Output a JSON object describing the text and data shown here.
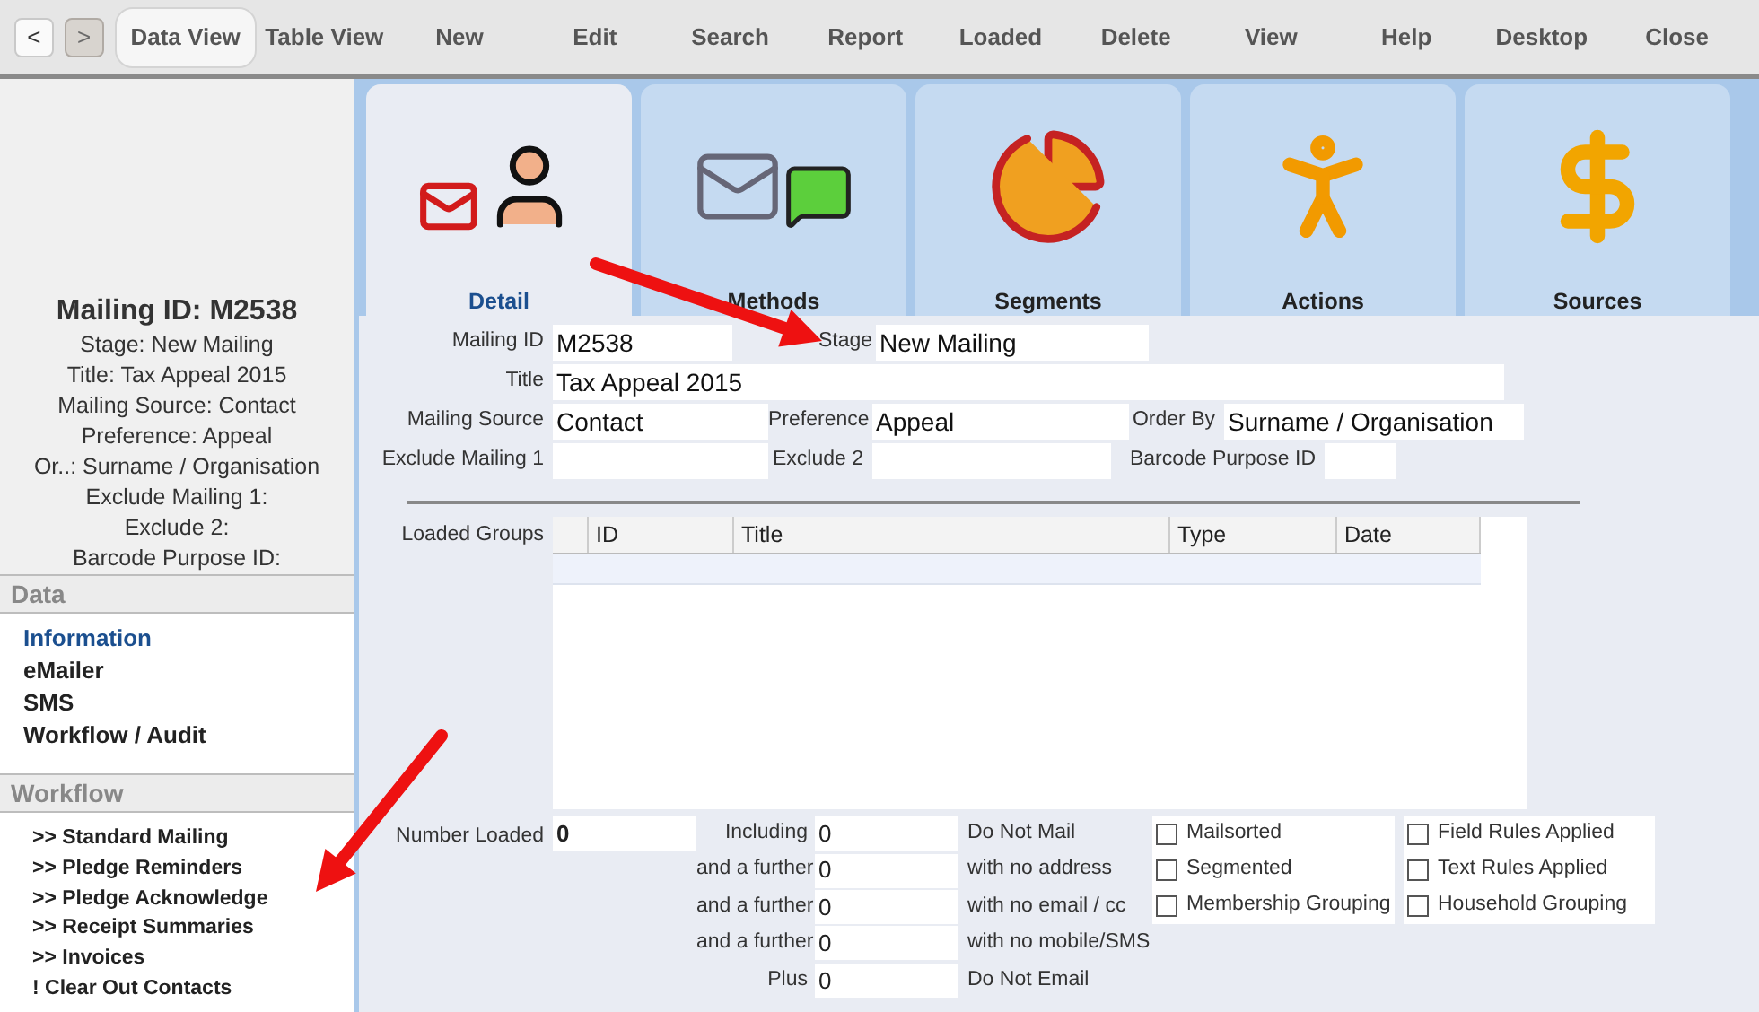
{
  "toolbar": {
    "nav": [
      {
        "label": "<",
        "disabled": false
      },
      {
        "label": ">",
        "disabled": true
      }
    ],
    "items": [
      {
        "label": "Data View",
        "selected": true
      },
      {
        "label": "Table View",
        "selected": false
      },
      {
        "label": "New",
        "selected": false
      },
      {
        "label": "Edit",
        "selected": false
      },
      {
        "label": "Search",
        "selected": false
      },
      {
        "label": "Report",
        "selected": false
      },
      {
        "label": "Loaded",
        "selected": false
      },
      {
        "label": "Delete",
        "selected": false
      },
      {
        "label": "View",
        "selected": false
      },
      {
        "label": "Help",
        "selected": false
      },
      {
        "label": "Desktop",
        "selected": false
      },
      {
        "label": "Close",
        "selected": false
      }
    ]
  },
  "sidebar": {
    "summary": {
      "title": "Mailing ID: M2538",
      "lines": [
        "Stage: New Mailing",
        "Title: Tax Appeal 2015",
        "Mailing Source: Contact",
        "Preference: Appeal",
        "Or..: Surname / Organisation",
        "Exclude Mailing 1:",
        "Exclude 2:",
        "Barcode Purpose ID:"
      ]
    },
    "sections": [
      {
        "title": "Data",
        "kind": "links",
        "items": [
          {
            "label": "Information",
            "selected": true
          },
          {
            "label": "eMailer",
            "selected": false
          },
          {
            "label": "SMS",
            "selected": false
          },
          {
            "label": "Workflow / Audit",
            "selected": false
          }
        ]
      },
      {
        "title": "Workflow",
        "kind": "actions",
        "items": [
          {
            "label": ">> Standard Mailing",
            "selected": false
          },
          {
            "label": ">> Pledge Reminders",
            "selected": false
          },
          {
            "label": ">> Pledge Acknowledge",
            "selected": false
          },
          {
            "label": ">> Receipt Summaries",
            "selected": false
          },
          {
            "label": ">> Invoices",
            "selected": false
          },
          {
            "label": "! Clear Out Contacts",
            "selected": false
          }
        ]
      }
    ]
  },
  "tabs": [
    {
      "label": "Detail",
      "selected": true
    },
    {
      "label": "Methods",
      "selected": false
    },
    {
      "label": "Segments",
      "selected": false
    },
    {
      "label": "Actions",
      "selected": false
    },
    {
      "label": "Sources",
      "selected": false
    }
  ],
  "form": {
    "rows": [
      [
        {
          "label": "Mailing ID",
          "value": "M2538"
        },
        {
          "label": "Stage",
          "value": "New Mailing"
        }
      ],
      [
        {
          "label": "Title",
          "value": "Tax Appeal 2015"
        }
      ],
      [
        {
          "label": "Mailing Source",
          "value": "Contact"
        },
        {
          "label": "Preference",
          "value": "Appeal"
        },
        {
          "label": "Order By",
          "value": "Surname / Organisation"
        }
      ],
      [
        {
          "label": "Exclude Mailing 1"
        },
        {
          "label": "Exclude 2"
        },
        {
          "label": "Barcode Purpose ID"
        }
      ]
    ]
  },
  "loaded_groups": {
    "label": "Loaded Groups",
    "columns": [
      "ID",
      "Title",
      "Type",
      "Date"
    ]
  },
  "counts": {
    "number_loaded": {
      "label": "Number Loaded",
      "value": "0"
    },
    "rows": [
      {
        "label": "Including",
        "value": "0",
        "note": "Do Not Mail"
      },
      {
        "label": "and a further",
        "value": "0",
        "note": "with no address"
      },
      {
        "label": "and a further",
        "value": "0",
        "note": "with no email / cc"
      },
      {
        "label": "and a further",
        "value": "0",
        "note": "with no mobile/SMS"
      },
      {
        "label": "Plus",
        "value": "0",
        "note": "Do Not Email"
      }
    ]
  },
  "checkboxes": [
    {
      "label": "Mailsorted",
      "checked": false
    },
    {
      "label": "Field Rules Applied",
      "checked": false
    },
    {
      "label": "Segmented",
      "checked": false
    },
    {
      "label": "Text Rules Applied",
      "checked": false
    },
    {
      "label": "Membership Grouping",
      "checked": false
    },
    {
      "label": "Household Grouping",
      "checked": false
    }
  ]
}
